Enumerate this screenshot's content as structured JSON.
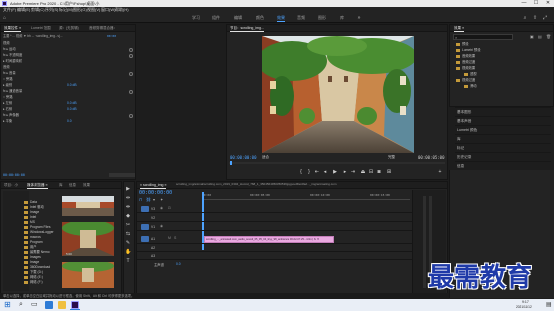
{
  "window": {
    "title": "Adobe Premiere Pro 2020 - C:\\用户\\Fshop\\桌面\\小",
    "buttons": {
      "minimize": "—",
      "maximize": "☐",
      "close": "✕"
    }
  },
  "menu": [
    "文件(F)",
    "编辑(E)",
    "剪辑(C)",
    "序列(S)",
    "标记(M)",
    "图形(G)",
    "视图(V)",
    "窗口(W)",
    "帮助(H)"
  ],
  "workspaces": {
    "items": [
      "学习",
      "组件",
      "编辑",
      "颜色",
      "效果",
      "音频",
      "图形",
      "库"
    ],
    "active_index": 4
  },
  "source_panel": {
    "tabs": [
      "效果控件 ≡",
      "Lumetri 范围",
      "源：(无剪辑)",
      "音频剪辑混合器："
    ],
    "header": "主要 * ... 视频 ▼ bh ... ·scrolling_img...vj...",
    "clip_timecode": "00:00",
    "rows": [
      {
        "label": "视频",
        "value": ""
      },
      {
        "label": "fx  ▸ 运动",
        "value": ""
      },
      {
        "label": "fx  ▸ 不透明度",
        "value": ""
      },
      {
        "label": "  ▸ 时间重映射",
        "value": ""
      },
      {
        "label": "音频",
        "value": ""
      },
      {
        "label": "fx  ▸ 音量",
        "value": ""
      },
      {
        "label": "   ○  旁路",
        "value": ""
      },
      {
        "label": "   ▸ 级别",
        "value": "0.0 dB"
      },
      {
        "label": "fx  ▸ 通道音量",
        "value": ""
      },
      {
        "label": "   ○  旁路",
        "value": ""
      },
      {
        "label": "   ▸ 左侧",
        "value": "0.0 dB"
      },
      {
        "label": "   ▸ 右侧",
        "value": "0.0 dB"
      },
      {
        "label": "fx  ▸ 声像器",
        "value": ""
      },
      {
        "label": "   ▸ 平衡",
        "value": "0.0"
      }
    ],
    "bottom_timecode": "00:00:00:00"
  },
  "program_monitor": {
    "tab": "节目：scrolling_img...",
    "timecode_current": "00:00:00:00",
    "fit_label": "适合",
    "quality_label": "完整",
    "timecode_duration": "00:00:05:00"
  },
  "project_panel": {
    "tabs": [
      "项目：小",
      "媒体浏览器 ≡",
      "库",
      "信息",
      "效果"
    ],
    "folder_items": [
      "Data",
      "Intel 驱动",
      "Image",
      "Intel",
      "MS",
      "Program Files",
      "WindowsLogger",
      "macros",
      "Program",
      "用户",
      "最需要 Nemo",
      "Images",
      "Image",
      "360Download",
      "下载 (D:)",
      "网络 (E:)",
      "网络 (F:)"
    ],
    "thumb_label": "5:00"
  },
  "timeline": {
    "tab": "× scrolling_img  ≡",
    "header_path": "scrolling_img/animal/scrolling.com_2019_0304_Humid_768_1_3504564950350536jpgpoolfile/dfa2..._img/animating.com",
    "timecode": "00:00:00:00",
    "video_tracks": [
      "V3",
      "V2",
      "V1"
    ],
    "audio_tracks": [
      "A1",
      "A2",
      "A3"
    ],
    "master_label": "主声道",
    "master_value": "0.0",
    "clip_label": "scrolling_..._animated.com_audio_sound_05_05_04_tkyy_98_ambience 00-02-07.25...4.0m | fx ▼",
    "ruler_labels": [
      "00:00",
      "00:00:05:00",
      "00:00:10:00",
      "00:00:15:00"
    ]
  },
  "tools": [
    "▶",
    "⇹",
    "⇼",
    "◆",
    "✂",
    "⇆",
    "✎",
    "✋",
    "T"
  ],
  "effects_panel": {
    "title": "效果 ≡",
    "search_placeholder": "",
    "tree": [
      {
        "label": "预设",
        "indent": 0
      },
      {
        "label": "Lumetri 预设",
        "indent": 0
      },
      {
        "label": "音频效果",
        "indent": 0
      },
      {
        "label": "音频过渡",
        "indent": 0
      },
      {
        "label": "视频效果",
        "indent": 0
      },
      {
        "label": "透视",
        "indent": 1
      },
      {
        "label": "视频过渡",
        "indent": 0
      },
      {
        "label": "滑动",
        "indent": 1
      }
    ],
    "sections": [
      "基本图形",
      "基本声音",
      "Lumetri 颜色",
      "库",
      "标记",
      "历史记录",
      "信息"
    ]
  },
  "status_bar": {
    "message": "单击以选择，或单击空白区域并拖动以进行框选。使用 Shift、Alt 和 Ctrl 可获得更多选项。"
  },
  "watermark": {
    "text": "最需教育"
  },
  "taskbar": {
    "time": "9:17",
    "date": "2021/11/12"
  },
  "colors": {
    "accent": "#4da3ff",
    "clip_audio": "#e9a9e0",
    "panel_bg": "#232323",
    "workspace_active": "#4da3ff"
  }
}
